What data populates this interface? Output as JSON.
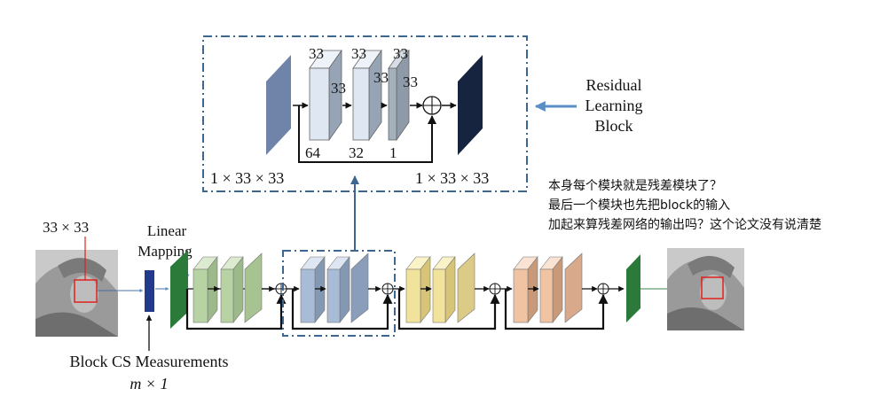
{
  "residual_block": {
    "label_line1": "Residual",
    "label_line2": "Learning",
    "label_line3": "Block",
    "kernel_labels": [
      "33",
      "33",
      "33",
      "33",
      "33",
      "33"
    ],
    "channel_labels": [
      "64",
      "32",
      "1"
    ],
    "input_dim": "1 × 33 × 33",
    "output_dim": "1 × 33 × 33"
  },
  "pipeline": {
    "block_size": "33 × 33",
    "linear_mapping_line1": "Linear",
    "linear_mapping_line2": "Mapping",
    "measurements_label": "Block CS Measurements",
    "measurements_dim": "m × 1"
  },
  "annotation": {
    "line1": "本身每个模块就是残差模块了？",
    "line2": "最后一个模块也先把block的输入",
    "line3": "加起来算残差网络的输出吗？这个论文没有说清楚"
  },
  "colors": {
    "dash_frame": "#3d6690",
    "arrow_blue": "#5b8ec4",
    "input_layer": "#6f84a8",
    "output_layer": "#16243f",
    "green": "#b7d3a3",
    "blue": "#a8bcd8",
    "yellow": "#f2e39c",
    "orange": "#f0c3a3",
    "dark_green": "#2b7a3a",
    "navy": "#213a8c"
  }
}
